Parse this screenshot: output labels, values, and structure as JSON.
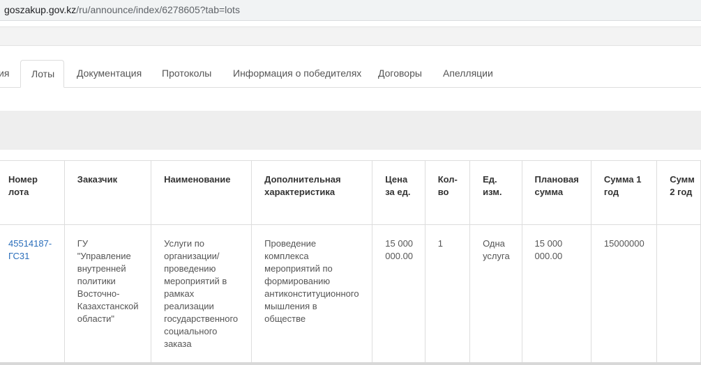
{
  "browser": {
    "url_host": "goszakup.gov.kz",
    "url_path": "/ru/announce/index/6278605?tab=lots"
  },
  "tabs": [
    {
      "label": "ия"
    },
    {
      "label": "Лоты",
      "active": true
    },
    {
      "label": "Документация"
    },
    {
      "label": "Протоколы"
    },
    {
      "label": "Информация о победителях"
    },
    {
      "label": "Договоры"
    },
    {
      "label": "Апелляции"
    }
  ],
  "table": {
    "headers": [
      "Номер\nлота",
      "Заказчик",
      "Наименование",
      "Дополнительная\nхарактеристика",
      "Цена\nза ед.",
      "Кол-\nво",
      "Ед.\nизм.",
      "Плановая\nсумма",
      "Сумма 1\nгод",
      "Сумм\n2 год"
    ],
    "rows": [
      {
        "lot_number": "45514187-\nГС31",
        "customer": "ГУ\n\"Управление\nвнутренней\nполитики\nВосточно-\nКазахстанской\nобласти\"",
        "name": "Услуги по\nорганизации/\nпроведению\nмероприятий в\nрамках\nреализации\nгосударственного\nсоциального\nзаказа",
        "extra": "Проведение\nкомплекса\nмероприятий по\nформированию\nантиконституционного\nмышления в\nобществе",
        "price": "15 000\n000.00",
        "qty": "1",
        "unit": "Одна\nуслуга",
        "planned": "15 000\n000.00",
        "year1": "15000000",
        "year2": ""
      }
    ]
  }
}
